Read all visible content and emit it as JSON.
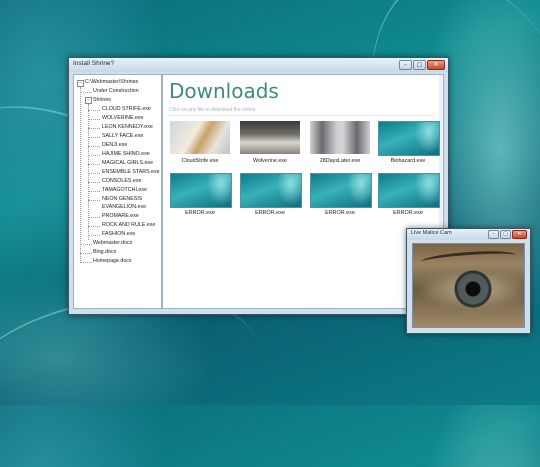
{
  "main_window": {
    "title": "Install Shrine?",
    "controls": {
      "minimize": "–",
      "maximize": "□",
      "close": "✕"
    }
  },
  "tree": {
    "root": "C:\\Webmaster\\Shrines",
    "items": [
      "Under Construction",
      "Shrines",
      "CLOUD STRIFE.exe",
      "WOLVERINE.exe",
      "LEON KENNEDY.exe",
      "SALLY FACE.exe",
      "DENJI.exe",
      "HAJIME SHINO.exe",
      "MAGICAL GIRLS.exe",
      "ENSEMBLE STARS.exe",
      "CONSOLES.exe",
      "TAMAGOTCHI.exe",
      "NEON GENESIS",
      "EVANGELION.exe",
      "PROMARE.exe",
      "ROCK AND RULE.exe",
      "FASHION.exe",
      "Webmaster.docx",
      "Blog.docx",
      "Homepage.docx"
    ]
  },
  "content": {
    "heading": "Downloads",
    "subtext": "Click on any file to download the shrine.",
    "files": [
      {
        "name": "CloudStrife.exe"
      },
      {
        "name": "Wolverine.exe"
      },
      {
        "name": "28DaysLater.exe"
      },
      {
        "name": "Biohazard.exe"
      },
      {
        "name": "ERROR.exe"
      },
      {
        "name": "ERROR.exe"
      },
      {
        "name": "ERROR.exe"
      },
      {
        "name": "ERROR.exe"
      }
    ]
  },
  "cam_window": {
    "title": "Live Malice Cam",
    "controls": {
      "minimize": "–",
      "maximize": "□",
      "close": "✕"
    }
  },
  "colors": {
    "heading": "#3b8f77",
    "desktop": "#0f8a8e"
  }
}
